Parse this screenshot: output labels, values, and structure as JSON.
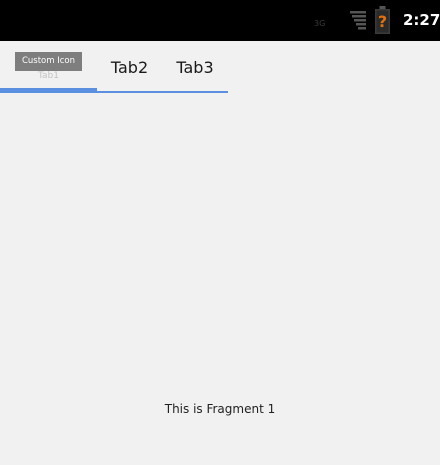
{
  "status_bar": {
    "network": "3G",
    "time": "2:27",
    "signal_icon": "signal-strength-icon",
    "battery_icon": "battery-unknown-icon",
    "battery_color": "#e07010"
  },
  "tabs": [
    {
      "label": "Tab1",
      "icon_text": "Custom Icon",
      "selected": true
    },
    {
      "label": "Tab2",
      "selected": false
    },
    {
      "label": "Tab3",
      "selected": false
    }
  ],
  "accent_color": "#5b8fe0",
  "fragment": {
    "text": "This is Fragment 1"
  }
}
